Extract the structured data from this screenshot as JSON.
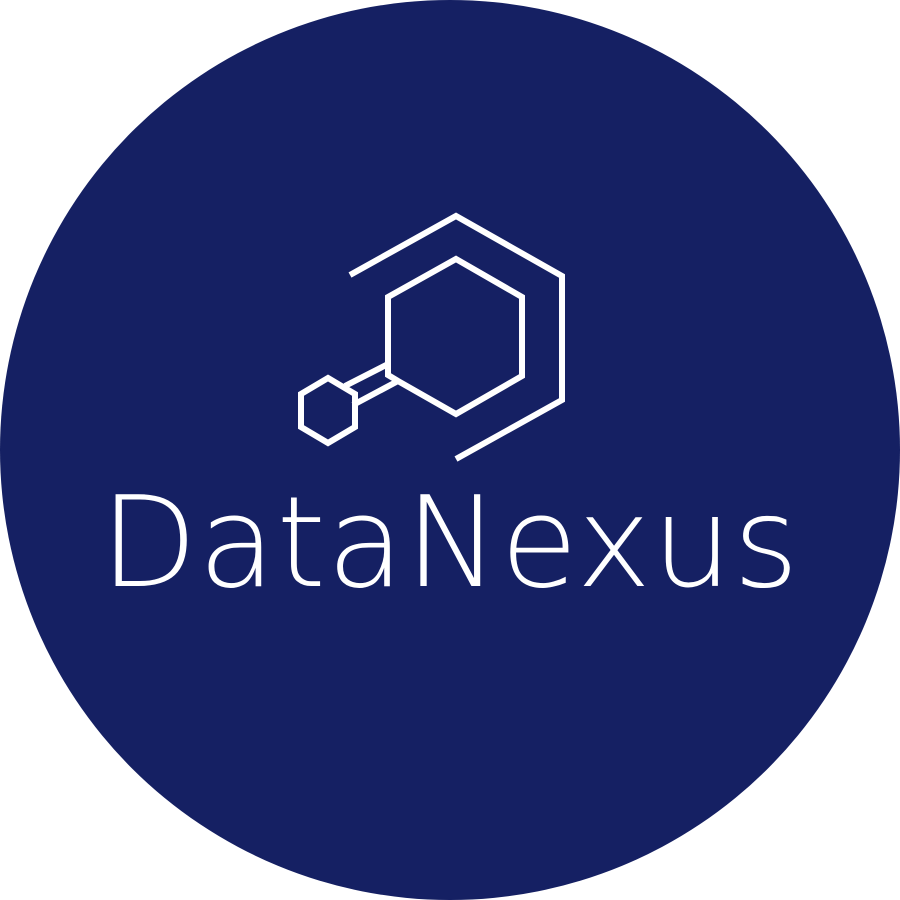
{
  "logo": {
    "brand_name": "DataNexus",
    "colors": {
      "background": "#152063",
      "foreground": "#ffffff",
      "page": "#ffffff"
    },
    "icon": "hexagon-network-icon"
  }
}
